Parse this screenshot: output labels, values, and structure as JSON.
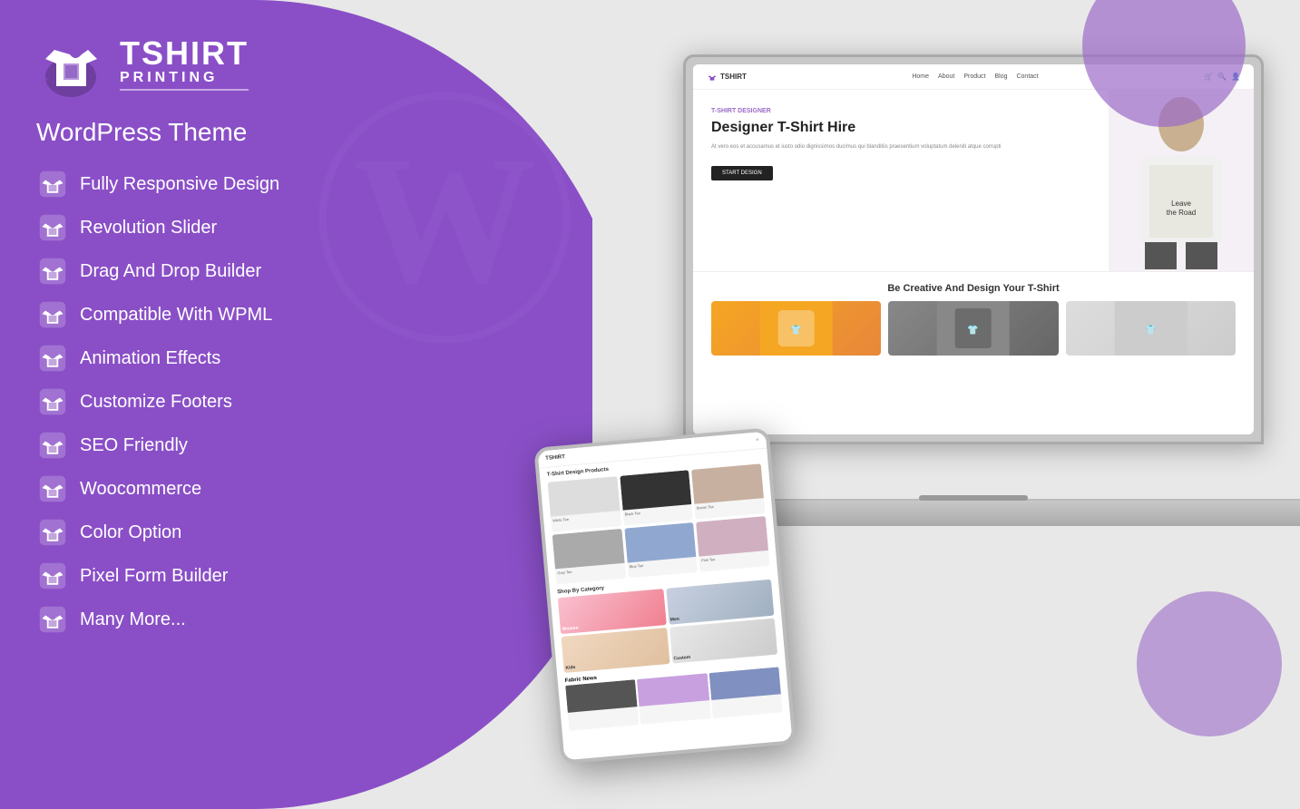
{
  "logo": {
    "title": "TSHIRT",
    "subtitle": "PRINTING"
  },
  "theme_label": "WordPress Theme",
  "features": [
    {
      "id": "responsive",
      "text": "Fully Responsive Design"
    },
    {
      "id": "revolution-slider",
      "text": "Revolution Slider"
    },
    {
      "id": "drag-drop",
      "text": "Drag And Drop Builder"
    },
    {
      "id": "wpml",
      "text": "Compatible With WPML"
    },
    {
      "id": "animation",
      "text": "Animation Effects"
    },
    {
      "id": "footers",
      "text": "Customize Footers"
    },
    {
      "id": "seo",
      "text": "SEO Friendly"
    },
    {
      "id": "woocommerce",
      "text": "Woocommerce"
    },
    {
      "id": "color",
      "text": "Color Option"
    },
    {
      "id": "pixel-form",
      "text": "Pixel Form Builder"
    },
    {
      "id": "more",
      "text": "Many More..."
    }
  ],
  "website_preview": {
    "nav": {
      "logo": "TSHIRT",
      "links": [
        "Home",
        "About",
        "Product",
        "Blog",
        "Contact"
      ]
    },
    "hero": {
      "label": "T-SHIRT DESIGNER",
      "title": "Designer T-Shirt Hire",
      "description": "At vero eos et accusamus et iusto odio dignissimos ducimus qui blanditiis praesentium voluptatum deleniti atque corrupti",
      "button": "START DESIGN"
    },
    "section_title": "Be Creative And Design Your T-Shirt"
  },
  "tablet_preview": {
    "section1": "T-Shirt Design Products",
    "section2": "Shop By Category",
    "section3": "Fabric News"
  },
  "colors": {
    "purple": "#8a4fc7",
    "purple_light": "#9b6bc7",
    "white": "#ffffff",
    "dark": "#222222"
  }
}
